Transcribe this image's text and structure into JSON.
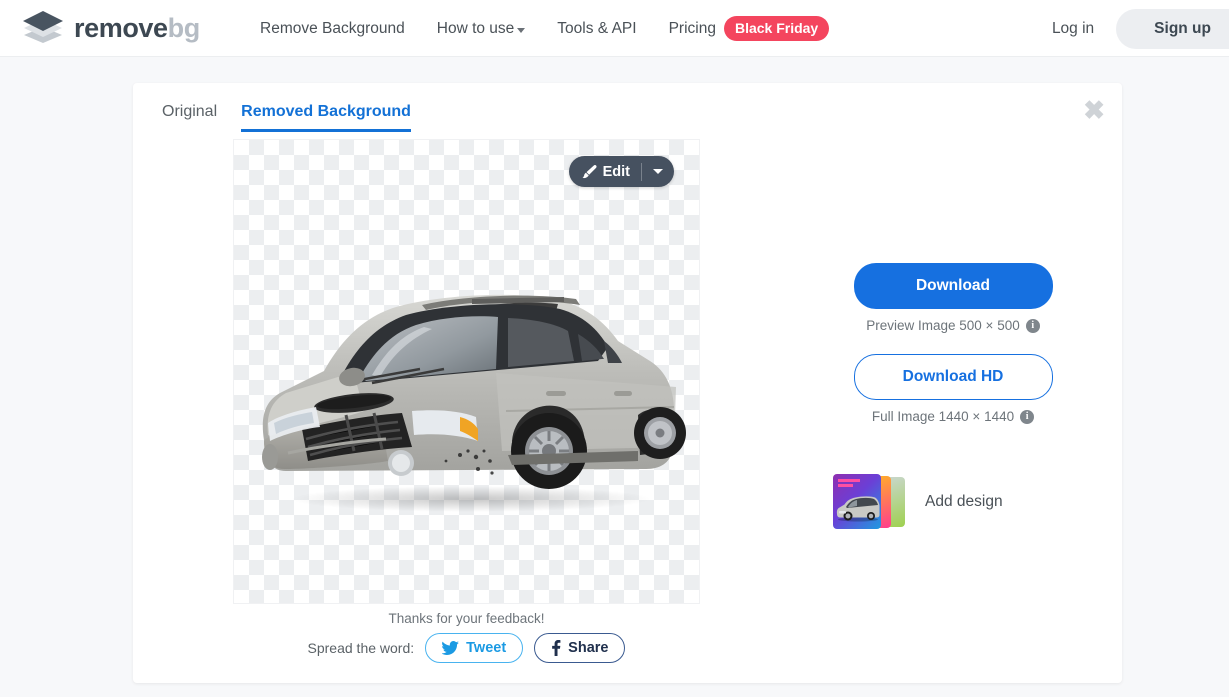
{
  "header": {
    "logo": {
      "primary": "remove",
      "secondary": "bg",
      "icon": "stacked-layers-logo"
    },
    "nav": [
      {
        "label": "Remove Background",
        "has_caret": false
      },
      {
        "label": "How to use",
        "has_caret": true
      },
      {
        "label": "Tools & API",
        "has_caret": false
      },
      {
        "label": "Pricing",
        "has_caret": false,
        "badge": "Black Friday"
      }
    ],
    "login_label": "Log in",
    "signup_label": "Sign up",
    "badge_color": "#f4455e"
  },
  "card": {
    "close_icon": "✖",
    "tabs": [
      {
        "label": "Original",
        "active": false
      },
      {
        "label": "Removed Background",
        "active": true
      }
    ],
    "active_tab_color": "#1371d6",
    "image": {
      "alt": "silver-suv-transparent-background",
      "edit_button": {
        "label": "Edit",
        "icon": "brush-icon",
        "caret": "chevron-down-icon"
      }
    },
    "feedback_text": "Thanks for your feedback!",
    "spread_label": "Spread the word:",
    "social": [
      {
        "label": "Tweet",
        "icon": "twitter-bird-icon",
        "color": "#1b9ae3"
      },
      {
        "label": "Share",
        "icon": "facebook-f-icon",
        "color": "#20304d"
      }
    ]
  },
  "actions": {
    "download_label": "Download",
    "download_note": "Preview Image 500 × 500",
    "download_hd_label": "Download HD",
    "download_hd_note": "Full Image 1440 × 1440",
    "info_glyph": "i",
    "add_design_label": "Add design",
    "primary_color": "#1670e0"
  }
}
